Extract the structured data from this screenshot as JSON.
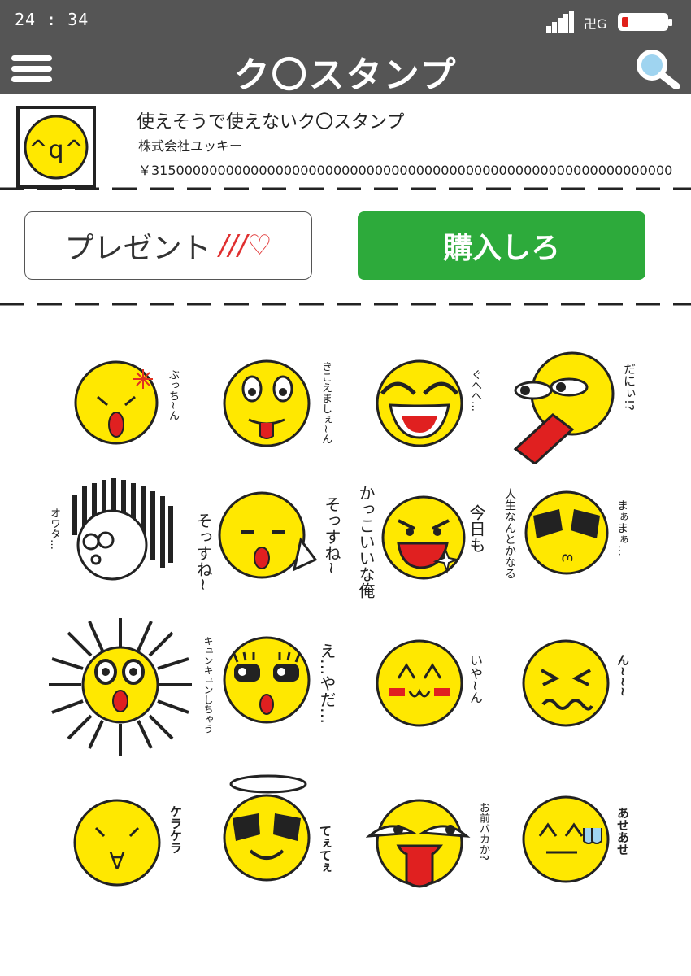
{
  "status": {
    "time": "24 : 34",
    "network": "卍G"
  },
  "header": {
    "title": "ク〇スタンプ"
  },
  "product": {
    "icon_face_text": "^q^",
    "name": "使えそうで使えないク〇スタンプ",
    "publisher": "株式会社ユッキー",
    "price": "￥315000000000000000000000000000000000000000000000000000000000000"
  },
  "buttons": {
    "present": "プレゼント",
    "present_deco": "///♡",
    "buy": "購入しろ"
  },
  "stickers": [
    {
      "label": "ぶっち~ん"
    },
    {
      "label": "きこえましぇ~ん"
    },
    {
      "label": "ぐへへ…"
    },
    {
      "label": "だにぃ!?"
    },
    {
      "label": "オワタ…"
    },
    {
      "label": "そっすね~",
      "label2": "そっすね~"
    },
    {
      "label": "かっこいいな俺",
      "label2": "今日も"
    },
    {
      "label": "人生なんとかなる",
      "label2": "まぁまぁ…"
    },
    {
      "label": "キュンキュンしちゃう",
      "label2": "え…やだ…"
    },
    {
      "label": "いや~ん"
    },
    {
      "label": "ん~~~"
    },
    {
      "label": "ケラケラ"
    },
    {
      "label": "てぇてぇ"
    },
    {
      "label": "お前バカか?"
    },
    {
      "label": "あせあせ"
    }
  ],
  "colors": {
    "bar": "#555555",
    "face": "#ffe800",
    "buy": "#2daa3b",
    "accent": "#e03030"
  }
}
